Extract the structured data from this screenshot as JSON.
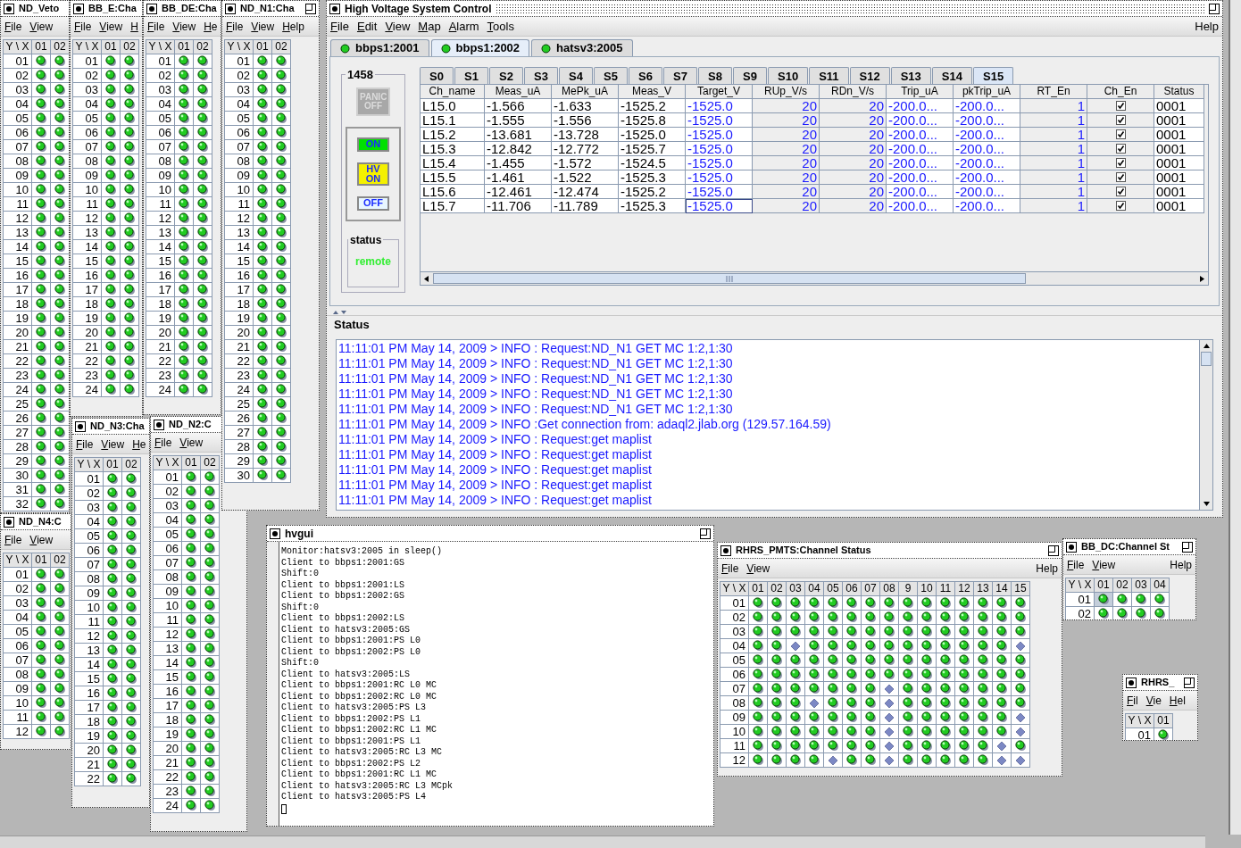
{
  "windows": [
    {
      "kind": "grid",
      "title": "ND_Veto",
      "maximize_button": false,
      "menu": [
        "File",
        "View"
      ],
      "columns": [
        "Y \\ X",
        "01",
        "02"
      ],
      "rows": [
        {
          "label": "01",
          "faulted": [
            false,
            false
          ]
        },
        {
          "label": "02",
          "faulted": [
            false,
            false
          ]
        },
        {
          "label": "03",
          "faulted": [
            false,
            false
          ]
        },
        {
          "label": "04",
          "faulted": [
            false,
            false
          ]
        },
        {
          "label": "05",
          "faulted": [
            false,
            false
          ]
        },
        {
          "label": "06",
          "faulted": [
            false,
            false
          ]
        },
        {
          "label": "07",
          "faulted": [
            false,
            false
          ]
        },
        {
          "label": "08",
          "faulted": [
            false,
            false
          ]
        },
        {
          "label": "09",
          "faulted": [
            false,
            false
          ]
        },
        {
          "label": "10",
          "faulted": [
            false,
            false
          ]
        },
        {
          "label": "11",
          "faulted": [
            false,
            false
          ]
        },
        {
          "label": "12",
          "faulted": [
            false,
            false
          ]
        },
        {
          "label": "13",
          "faulted": [
            false,
            false
          ]
        },
        {
          "label": "14",
          "faulted": [
            false,
            false
          ]
        },
        {
          "label": "15",
          "faulted": [
            false,
            false
          ]
        },
        {
          "label": "16",
          "faulted": [
            false,
            false
          ]
        },
        {
          "label": "17",
          "faulted": [
            false,
            false
          ]
        },
        {
          "label": "18",
          "faulted": [
            false,
            false
          ]
        },
        {
          "label": "19",
          "faulted": [
            false,
            false
          ]
        },
        {
          "label": "20",
          "faulted": [
            false,
            false
          ]
        },
        {
          "label": "21",
          "faulted": [
            false,
            false
          ]
        },
        {
          "label": "22",
          "faulted": [
            false,
            false
          ]
        },
        {
          "label": "23",
          "faulted": [
            false,
            false
          ]
        },
        {
          "label": "24",
          "faulted": [
            false,
            false
          ]
        },
        {
          "label": "25",
          "faulted": [
            false,
            false
          ]
        },
        {
          "label": "26",
          "faulted": [
            false,
            false
          ]
        },
        {
          "label": "27",
          "faulted": [
            false,
            false
          ]
        },
        {
          "label": "28",
          "faulted": [
            false,
            false
          ]
        },
        {
          "label": "29",
          "faulted": [
            false,
            false
          ]
        },
        {
          "label": "30",
          "faulted": [
            false,
            false
          ]
        },
        {
          "label": "31",
          "faulted": [
            false,
            false
          ]
        },
        {
          "label": "32",
          "faulted": [
            false,
            false
          ]
        }
      ]
    },
    {
      "kind": "grid",
      "title": "BB_E:Cha",
      "maximize_button": false,
      "menu": [
        "File",
        "View",
        "H"
      ],
      "columns": [
        "Y \\ X",
        "01",
        "02"
      ],
      "rows": [
        {
          "label": "01",
          "faulted": [
            false,
            false
          ]
        },
        {
          "label": "02",
          "faulted": [
            false,
            false
          ]
        },
        {
          "label": "03",
          "faulted": [
            false,
            false
          ]
        },
        {
          "label": "04",
          "faulted": [
            false,
            false
          ]
        },
        {
          "label": "05",
          "faulted": [
            false,
            false
          ]
        },
        {
          "label": "06",
          "faulted": [
            false,
            false
          ]
        },
        {
          "label": "07",
          "faulted": [
            false,
            false
          ]
        },
        {
          "label": "08",
          "faulted": [
            false,
            false
          ]
        },
        {
          "label": "09",
          "faulted": [
            false,
            false
          ]
        },
        {
          "label": "10",
          "faulted": [
            false,
            false
          ]
        },
        {
          "label": "11",
          "faulted": [
            false,
            false
          ]
        },
        {
          "label": "12",
          "faulted": [
            false,
            false
          ]
        },
        {
          "label": "13",
          "faulted": [
            false,
            false
          ]
        },
        {
          "label": "14",
          "faulted": [
            false,
            false
          ]
        },
        {
          "label": "15",
          "faulted": [
            false,
            false
          ]
        },
        {
          "label": "16",
          "faulted": [
            false,
            false
          ]
        },
        {
          "label": "17",
          "faulted": [
            false,
            false
          ]
        },
        {
          "label": "18",
          "faulted": [
            false,
            false
          ]
        },
        {
          "label": "19",
          "faulted": [
            false,
            false
          ]
        },
        {
          "label": "20",
          "faulted": [
            false,
            false
          ]
        },
        {
          "label": "21",
          "faulted": [
            false,
            false
          ]
        },
        {
          "label": "22",
          "faulted": [
            false,
            false
          ]
        },
        {
          "label": "23",
          "faulted": [
            false,
            false
          ]
        },
        {
          "label": "24",
          "faulted": [
            false,
            false
          ]
        }
      ]
    },
    {
      "kind": "grid",
      "title": "BB_DE:Cha",
      "maximize_button": false,
      "menu": [
        "File",
        "View",
        "He"
      ],
      "columns": [
        "Y \\ X",
        "01",
        "02"
      ],
      "rows": [
        {
          "label": "01",
          "faulted": [
            false,
            false
          ]
        },
        {
          "label": "02",
          "faulted": [
            false,
            false
          ]
        },
        {
          "label": "03",
          "faulted": [
            false,
            false
          ]
        },
        {
          "label": "04",
          "faulted": [
            false,
            false
          ]
        },
        {
          "label": "05",
          "faulted": [
            false,
            false
          ]
        },
        {
          "label": "06",
          "faulted": [
            false,
            false
          ]
        },
        {
          "label": "07",
          "faulted": [
            false,
            false
          ]
        },
        {
          "label": "08",
          "faulted": [
            false,
            false
          ]
        },
        {
          "label": "09",
          "faulted": [
            false,
            false
          ]
        },
        {
          "label": "10",
          "faulted": [
            false,
            false
          ]
        },
        {
          "label": "11",
          "faulted": [
            false,
            false
          ]
        },
        {
          "label": "12",
          "faulted": [
            false,
            false
          ]
        },
        {
          "label": "13",
          "faulted": [
            false,
            false
          ]
        },
        {
          "label": "14",
          "faulted": [
            false,
            false
          ]
        },
        {
          "label": "15",
          "faulted": [
            false,
            false
          ]
        },
        {
          "label": "16",
          "faulted": [
            false,
            false
          ]
        },
        {
          "label": "17",
          "faulted": [
            false,
            false
          ]
        },
        {
          "label": "18",
          "faulted": [
            false,
            false
          ]
        },
        {
          "label": "19",
          "faulted": [
            false,
            false
          ]
        },
        {
          "label": "20",
          "faulted": [
            false,
            false
          ]
        },
        {
          "label": "21",
          "faulted": [
            false,
            false
          ]
        },
        {
          "label": "22",
          "faulted": [
            false,
            false
          ]
        },
        {
          "label": "23",
          "faulted": [
            false,
            false
          ]
        },
        {
          "label": "24",
          "faulted": [
            false,
            false
          ]
        }
      ]
    },
    {
      "kind": "grid",
      "title": "ND_N2:C",
      "maximize_button": false,
      "menu": [
        "File",
        "View"
      ],
      "columns": [
        "Y \\ X",
        "01",
        "02"
      ],
      "rows": [
        {
          "label": "01",
          "faulted": [
            false,
            false
          ]
        },
        {
          "label": "02",
          "faulted": [
            false,
            false
          ]
        },
        {
          "label": "03",
          "faulted": [
            false,
            false
          ]
        },
        {
          "label": "04",
          "faulted": [
            false,
            false
          ]
        },
        {
          "label": "05",
          "faulted": [
            false,
            false
          ]
        },
        {
          "label": "06",
          "faulted": [
            false,
            false
          ]
        },
        {
          "label": "07",
          "faulted": [
            false,
            false
          ]
        },
        {
          "label": "08",
          "faulted": [
            false,
            false
          ]
        },
        {
          "label": "09",
          "faulted": [
            false,
            false
          ]
        },
        {
          "label": "10",
          "faulted": [
            false,
            false
          ]
        },
        {
          "label": "11",
          "faulted": [
            false,
            false
          ]
        },
        {
          "label": "12",
          "faulted": [
            false,
            false
          ]
        },
        {
          "label": "13",
          "faulted": [
            false,
            false
          ]
        },
        {
          "label": "14",
          "faulted": [
            false,
            false
          ]
        },
        {
          "label": "15",
          "faulted": [
            false,
            false
          ]
        },
        {
          "label": "16",
          "faulted": [
            false,
            false
          ]
        },
        {
          "label": "17",
          "faulted": [
            false,
            false
          ]
        },
        {
          "label": "18",
          "faulted": [
            false,
            false
          ]
        },
        {
          "label": "19",
          "faulted": [
            false,
            false
          ]
        },
        {
          "label": "20",
          "faulted": [
            false,
            false
          ]
        },
        {
          "label": "21",
          "faulted": [
            false,
            false
          ]
        },
        {
          "label": "22",
          "faulted": [
            false,
            false
          ]
        },
        {
          "label": "23",
          "faulted": [
            false,
            false
          ]
        },
        {
          "label": "24",
          "faulted": [
            false,
            false
          ]
        }
      ]
    },
    {
      "kind": "grid",
      "title": "ND_N1:Cha",
      "maximize_button": true,
      "menu": [
        "File",
        "View",
        "Help"
      ],
      "columns": [
        "Y \\ X",
        "01",
        "02"
      ],
      "rows": [
        {
          "label": "01",
          "faulted": [
            false,
            false
          ]
        },
        {
          "label": "02",
          "faulted": [
            false,
            false
          ]
        },
        {
          "label": "03",
          "faulted": [
            false,
            false
          ]
        },
        {
          "label": "04",
          "faulted": [
            false,
            false
          ]
        },
        {
          "label": "05",
          "faulted": [
            false,
            false
          ]
        },
        {
          "label": "06",
          "faulted": [
            false,
            false
          ]
        },
        {
          "label": "07",
          "faulted": [
            false,
            false
          ]
        },
        {
          "label": "08",
          "faulted": [
            false,
            false
          ]
        },
        {
          "label": "09",
          "faulted": [
            false,
            false
          ]
        },
        {
          "label": "10",
          "faulted": [
            false,
            false
          ]
        },
        {
          "label": "11",
          "faulted": [
            false,
            false
          ]
        },
        {
          "label": "12",
          "faulted": [
            false,
            false
          ]
        },
        {
          "label": "13",
          "faulted": [
            false,
            false
          ]
        },
        {
          "label": "14",
          "faulted": [
            false,
            false
          ]
        },
        {
          "label": "15",
          "faulted": [
            false,
            false
          ]
        },
        {
          "label": "16",
          "faulted": [
            false,
            false
          ]
        },
        {
          "label": "17",
          "faulted": [
            false,
            false
          ]
        },
        {
          "label": "18",
          "faulted": [
            false,
            false
          ]
        },
        {
          "label": "19",
          "faulted": [
            false,
            false
          ]
        },
        {
          "label": "20",
          "faulted": [
            false,
            false
          ]
        },
        {
          "label": "21",
          "faulted": [
            false,
            false
          ]
        },
        {
          "label": "22",
          "faulted": [
            false,
            false
          ]
        },
        {
          "label": "23",
          "faulted": [
            false,
            false
          ]
        },
        {
          "label": "24",
          "faulted": [
            false,
            false
          ]
        },
        {
          "label": "25",
          "faulted": [
            false,
            false
          ]
        },
        {
          "label": "26",
          "faulted": [
            false,
            false
          ]
        },
        {
          "label": "27",
          "faulted": [
            false,
            false
          ]
        },
        {
          "label": "28",
          "faulted": [
            false,
            false
          ]
        },
        {
          "label": "29",
          "faulted": [
            false,
            false
          ]
        },
        {
          "label": "30",
          "faulted": [
            false,
            false
          ]
        }
      ]
    },
    {
      "kind": "grid",
      "title": "ND_N3:Cha",
      "maximize_button": false,
      "menu": [
        "File",
        "View",
        "He"
      ],
      "columns": [
        "Y \\ X",
        "01",
        "02"
      ],
      "rows": [
        {
          "label": "01",
          "faulted": [
            false,
            false
          ]
        },
        {
          "label": "02",
          "faulted": [
            false,
            false
          ]
        },
        {
          "label": "03",
          "faulted": [
            false,
            false
          ]
        },
        {
          "label": "04",
          "faulted": [
            false,
            false
          ]
        },
        {
          "label": "05",
          "faulted": [
            false,
            false
          ]
        },
        {
          "label": "06",
          "faulted": [
            false,
            false
          ]
        },
        {
          "label": "07",
          "faulted": [
            false,
            false
          ]
        },
        {
          "label": "08",
          "faulted": [
            false,
            false
          ]
        },
        {
          "label": "09",
          "faulted": [
            false,
            false
          ]
        },
        {
          "label": "10",
          "faulted": [
            false,
            false
          ]
        },
        {
          "label": "11",
          "faulted": [
            false,
            false
          ]
        },
        {
          "label": "12",
          "faulted": [
            false,
            false
          ]
        },
        {
          "label": "13",
          "faulted": [
            false,
            false
          ]
        },
        {
          "label": "14",
          "faulted": [
            false,
            false
          ]
        },
        {
          "label": "15",
          "faulted": [
            false,
            false
          ]
        },
        {
          "label": "16",
          "faulted": [
            false,
            false
          ]
        },
        {
          "label": "17",
          "faulted": [
            false,
            false
          ]
        },
        {
          "label": "18",
          "faulted": [
            false,
            false
          ]
        },
        {
          "label": "19",
          "faulted": [
            false,
            false
          ]
        },
        {
          "label": "20",
          "faulted": [
            false,
            false
          ]
        },
        {
          "label": "21",
          "faulted": [
            false,
            false
          ]
        },
        {
          "label": "22",
          "faulted": [
            false,
            false
          ]
        }
      ]
    },
    {
      "kind": "grid",
      "title": "ND_N4:C",
      "maximize_button": false,
      "menu": [
        "File",
        "View"
      ],
      "columns": [
        "Y \\ X",
        "01",
        "02"
      ],
      "rows": [
        {
          "label": "01",
          "faulted": [
            false,
            false
          ]
        },
        {
          "label": "02",
          "faulted": [
            false,
            false
          ]
        },
        {
          "label": "03",
          "faulted": [
            false,
            false
          ]
        },
        {
          "label": "04",
          "faulted": [
            false,
            false
          ]
        },
        {
          "label": "05",
          "faulted": [
            false,
            false
          ]
        },
        {
          "label": "06",
          "faulted": [
            false,
            false
          ]
        },
        {
          "label": "07",
          "faulted": [
            false,
            false
          ]
        },
        {
          "label": "08",
          "faulted": [
            false,
            false
          ]
        },
        {
          "label": "09",
          "faulted": [
            false,
            false
          ]
        },
        {
          "label": "10",
          "faulted": [
            false,
            false
          ]
        },
        {
          "label": "11",
          "faulted": [
            false,
            false
          ]
        },
        {
          "label": "12",
          "faulted": [
            false,
            false
          ]
        }
      ]
    },
    {
      "kind": "control",
      "title": "High Voltage System Control",
      "maximize_button": true,
      "menu": [
        "File",
        "Edit",
        "View",
        "Map",
        "Alarm",
        "Tools"
      ],
      "menu_right": [
        "Help"
      ],
      "hosts": [
        {
          "label": "bbps1:2001",
          "selected": false
        },
        {
          "label": "bbps1:2002",
          "selected": true
        },
        {
          "label": "hatsv3:2005",
          "selected": false
        }
      ],
      "crate": "1458",
      "panic_button": {
        "label": "PANIC OFF",
        "disabled": true
      },
      "power_buttons": [
        {
          "kind": "on",
          "label": "ON"
        },
        {
          "kind": "hv",
          "label": "HV ON"
        },
        {
          "kind": "off",
          "label": "OFF"
        }
      ],
      "status_group": "status",
      "status_value": "remote",
      "slots": [
        {
          "label": "S0",
          "selected": false
        },
        {
          "label": "S1",
          "selected": false
        },
        {
          "label": "S2",
          "selected": false
        },
        {
          "label": "S3",
          "selected": false
        },
        {
          "label": "S4",
          "selected": false
        },
        {
          "label": "S5",
          "selected": false
        },
        {
          "label": "S6",
          "selected": false
        },
        {
          "label": "S7",
          "selected": false
        },
        {
          "label": "S8",
          "selected": false
        },
        {
          "label": "S9",
          "selected": false
        },
        {
          "label": "S10",
          "selected": false
        },
        {
          "label": "S11",
          "selected": false
        },
        {
          "label": "S12",
          "selected": false
        },
        {
          "label": "S13",
          "selected": false
        },
        {
          "label": "S14",
          "selected": false
        },
        {
          "label": "S15",
          "selected": true
        }
      ],
      "columns": [
        "Ch_name",
        "Meas_uA",
        "MePk_uA",
        "Meas_V",
        "Target_V",
        "RUp_V/s",
        "RDn_V/s",
        "Trip_uA",
        "pkTrip_uA",
        "RT_En",
        "Ch_En",
        "Status"
      ],
      "rows": [
        {
          "cells": [
            "L15.0",
            "-1.566",
            "-1.633",
            "-1525.2",
            "-1525.0",
            "20",
            "20",
            "-200.0...",
            "-200.0...",
            "1"
          ],
          "ch_en": true,
          "status": "0001",
          "focused": false
        },
        {
          "cells": [
            "L15.1",
            "-1.555",
            "-1.556",
            "-1525.8",
            "-1525.0",
            "20",
            "20",
            "-200.0...",
            "-200.0...",
            "1"
          ],
          "ch_en": true,
          "status": "0001",
          "focused": false
        },
        {
          "cells": [
            "L15.2",
            "-13.681",
            "-13.728",
            "-1525.0",
            "-1525.0",
            "20",
            "20",
            "-200.0...",
            "-200.0...",
            "1"
          ],
          "ch_en": true,
          "status": "0001",
          "focused": false
        },
        {
          "cells": [
            "L15.3",
            "-12.842",
            "-12.772",
            "-1525.7",
            "-1525.0",
            "20",
            "20",
            "-200.0...",
            "-200.0...",
            "1"
          ],
          "ch_en": true,
          "status": "0001",
          "focused": false
        },
        {
          "cells": [
            "L15.4",
            "-1.455",
            "-1.572",
            "-1524.5",
            "-1525.0",
            "20",
            "20",
            "-200.0...",
            "-200.0...",
            "1"
          ],
          "ch_en": true,
          "status": "0001",
          "focused": false
        },
        {
          "cells": [
            "L15.5",
            "-1.461",
            "-1.522",
            "-1525.3",
            "-1525.0",
            "20",
            "20",
            "-200.0...",
            "-200.0...",
            "1"
          ],
          "ch_en": true,
          "status": "0001",
          "focused": false
        },
        {
          "cells": [
            "L15.6",
            "-12.461",
            "-12.474",
            "-1525.2",
            "-1525.0",
            "20",
            "20",
            "-200.0...",
            "-200.0...",
            "1"
          ],
          "ch_en": true,
          "status": "0001",
          "focused": false
        },
        {
          "cells": [
            "L15.7",
            "-11.706",
            "-11.789",
            "-1525.3",
            "-1525.0",
            "20",
            "20",
            "-200.0...",
            "-200.0...",
            "1"
          ],
          "ch_en": true,
          "status": "0001",
          "focused": true
        }
      ],
      "log_title": "Status",
      "log": [
        "11:11:01 PM May 14, 2009 > INFO : Request:ND_N1 GET MC 1:2,1:30",
        "11:11:01 PM May 14, 2009 > INFO : Request:ND_N1 GET MC 1:2,1:30",
        "11:11:01 PM May 14, 2009 > INFO : Request:ND_N1 GET MC 1:2,1:30",
        "11:11:01 PM May 14, 2009 > INFO : Request:ND_N1 GET MC 1:2,1:30",
        "11:11:01 PM May 14, 2009 > INFO : Request:ND_N1 GET MC 1:2,1:30",
        "11:11:01 PM May 14, 2009 > INFO :Get connection from: adaql2.jlab.org (129.57.164.59)",
        "11:11:01 PM May 14, 2009 > INFO : Request:get maplist",
        "11:11:01 PM May 14, 2009 > INFO : Request:get maplist",
        "11:11:01 PM May 14, 2009 > INFO : Request:get maplist",
        "11:11:01 PM May 14, 2009 > INFO : Request:get maplist",
        "11:11:01 PM May 14, 2009 > INFO : Request:get maplist"
      ]
    },
    {
      "kind": "console",
      "title": "hvgui",
      "maximize_button": true,
      "lines": [
        "Monitor:hatsv3:2005 in sleep()",
        "Client to bbps1:2001:GS",
        "Shift:0",
        "Client to bbps1:2001:LS",
        "Client to bbps1:2002:GS",
        "Shift:0",
        "Client to bbps1:2002:LS",
        "Client to hatsv3:2005:GS",
        "Client to bbps1:2001:PS L0",
        "Client to bbps1:2002:PS L0",
        "Shift:0",
        "Client to hatsv3:2005:LS",
        "Client to bbps1:2001:RC L0 MC",
        "Client to bbps1:2002:RC L0 MC",
        "Client to hatsv3:2005:PS L3",
        "Client to bbps1:2002:PS L1",
        "Client to bbps1:2002:RC L1 MC",
        "Client to bbps1:2001:PS L1",
        "Client to hatsv3:2005:RC L3 MC",
        "Client to bbps1:2002:PS L2",
        "Client to bbps1:2001:RC L1 MC",
        "Client to hatsv3:2005:RC L3 MCpk",
        "Client to hatsv3:2005:PS L4"
      ]
    },
    {
      "kind": "grid",
      "title": "RHRS_PMTS:Channel Status",
      "maximize_button": true,
      "menu": [
        "File",
        "View"
      ],
      "menu_right": [
        "Help"
      ],
      "columns": [
        "Y \\ X",
        "01",
        "02",
        "03",
        "04",
        "05",
        "06",
        "07",
        "08",
        "9",
        "10",
        "11",
        "12",
        "13",
        "14",
        "15"
      ],
      "rows": [
        {
          "label": "01",
          "faulted": [
            false,
            false,
            false,
            false,
            false,
            false,
            false,
            false,
            false,
            false,
            false,
            false,
            false,
            false,
            false
          ]
        },
        {
          "label": "02",
          "faulted": [
            false,
            false,
            false,
            false,
            false,
            false,
            false,
            false,
            false,
            false,
            false,
            false,
            false,
            false,
            false
          ]
        },
        {
          "label": "03",
          "faulted": [
            false,
            false,
            false,
            false,
            false,
            false,
            false,
            false,
            false,
            false,
            false,
            false,
            false,
            false,
            false
          ]
        },
        {
          "label": "04",
          "faulted": [
            false,
            false,
            true,
            false,
            false,
            false,
            false,
            false,
            false,
            false,
            false,
            false,
            false,
            false,
            true
          ]
        },
        {
          "label": "05",
          "faulted": [
            false,
            false,
            false,
            false,
            false,
            false,
            false,
            false,
            false,
            false,
            false,
            false,
            false,
            false,
            false
          ]
        },
        {
          "label": "06",
          "faulted": [
            false,
            false,
            false,
            false,
            false,
            false,
            false,
            false,
            false,
            false,
            false,
            false,
            false,
            false,
            false
          ]
        },
        {
          "label": "07",
          "faulted": [
            false,
            false,
            false,
            false,
            false,
            false,
            false,
            true,
            false,
            false,
            false,
            false,
            false,
            false,
            false
          ]
        },
        {
          "label": "08",
          "faulted": [
            false,
            false,
            false,
            true,
            false,
            false,
            false,
            true,
            false,
            false,
            false,
            false,
            false,
            false,
            false
          ]
        },
        {
          "label": "09",
          "faulted": [
            false,
            false,
            false,
            false,
            false,
            false,
            false,
            true,
            false,
            false,
            false,
            false,
            false,
            false,
            true
          ]
        },
        {
          "label": "10",
          "faulted": [
            false,
            false,
            false,
            false,
            false,
            false,
            false,
            true,
            false,
            false,
            false,
            false,
            false,
            false,
            true
          ]
        },
        {
          "label": "11",
          "faulted": [
            false,
            false,
            false,
            false,
            false,
            false,
            false,
            true,
            false,
            false,
            false,
            false,
            false,
            true,
            false
          ]
        },
        {
          "label": "12",
          "faulted": [
            false,
            false,
            false,
            false,
            true,
            false,
            false,
            true,
            false,
            false,
            false,
            false,
            false,
            true,
            true
          ]
        }
      ]
    },
    {
      "kind": "grid",
      "title": "BB_DC:Channel St",
      "maximize_button": true,
      "menu": [
        "File",
        "View"
      ],
      "menu_right": [
        "Help"
      ],
      "columns": [
        "Y \\ X",
        "01",
        "02",
        "03",
        "04"
      ],
      "rows": [
        {
          "label": "01",
          "faulted": [
            false,
            false,
            false,
            false
          ],
          "selected": [
            true,
            false,
            false,
            false
          ]
        },
        {
          "label": "02",
          "faulted": [
            false,
            false,
            false,
            false
          ],
          "selected": [
            false,
            false,
            false,
            false
          ]
        }
      ]
    },
    {
      "kind": "grid",
      "title": "RHRS_",
      "maximize_button": true,
      "menu": [
        "Fil",
        "Vie",
        "Hel"
      ],
      "columns": [
        "Y \\ X",
        "01"
      ],
      "rows": [
        {
          "label": "01",
          "faulted": [
            false
          ]
        }
      ]
    }
  ]
}
